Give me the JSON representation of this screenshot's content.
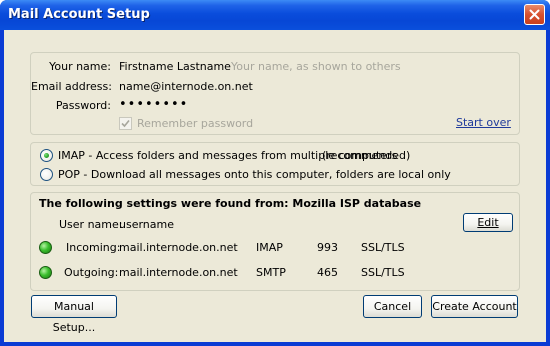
{
  "window": {
    "title": "Mail Account Setup",
    "title_color": "#0a4ddc"
  },
  "identity": {
    "name_label": "Your name:",
    "name_value": "Firstname Lastname",
    "name_hint": "Your name, as shown to others",
    "email_label": "Email address:",
    "email_value": "name@internode.on.net",
    "password_label": "Password:",
    "password_value": "••••••••",
    "remember_label": "Remember password",
    "remember_checked": true,
    "start_over": "Start over"
  },
  "protocol": {
    "imap_label": "IMAP - Access folders and messages from multiple computers",
    "imap_note": "(recommended)",
    "pop_label": "POP - Download all messages onto this computer, folders are local only",
    "selected": "IMAP"
  },
  "settings": {
    "heading": "The following settings were found from: Mozilla ISP database",
    "username_label": "User name:",
    "username_value": "username",
    "edit_label": "Edit",
    "incoming": {
      "label": "Incoming:",
      "server": "mail.internode.on.net",
      "protocol": "IMAP",
      "port": "993",
      "security": "SSL/TLS",
      "status_color": "#3bbf2e"
    },
    "outgoing": {
      "label": "Outgoing:",
      "server": "mail.internode.on.net",
      "protocol": "SMTP",
      "port": "465",
      "security": "SSL/TLS",
      "status_color": "#3bbf2e"
    }
  },
  "buttons": {
    "manual_setup": "Manual Setup...",
    "cancel": "Cancel",
    "create_account": "Create Account"
  },
  "icons": {
    "close": "close-icon",
    "checkmark": "checkmark-icon",
    "status": "status-led-icon"
  }
}
